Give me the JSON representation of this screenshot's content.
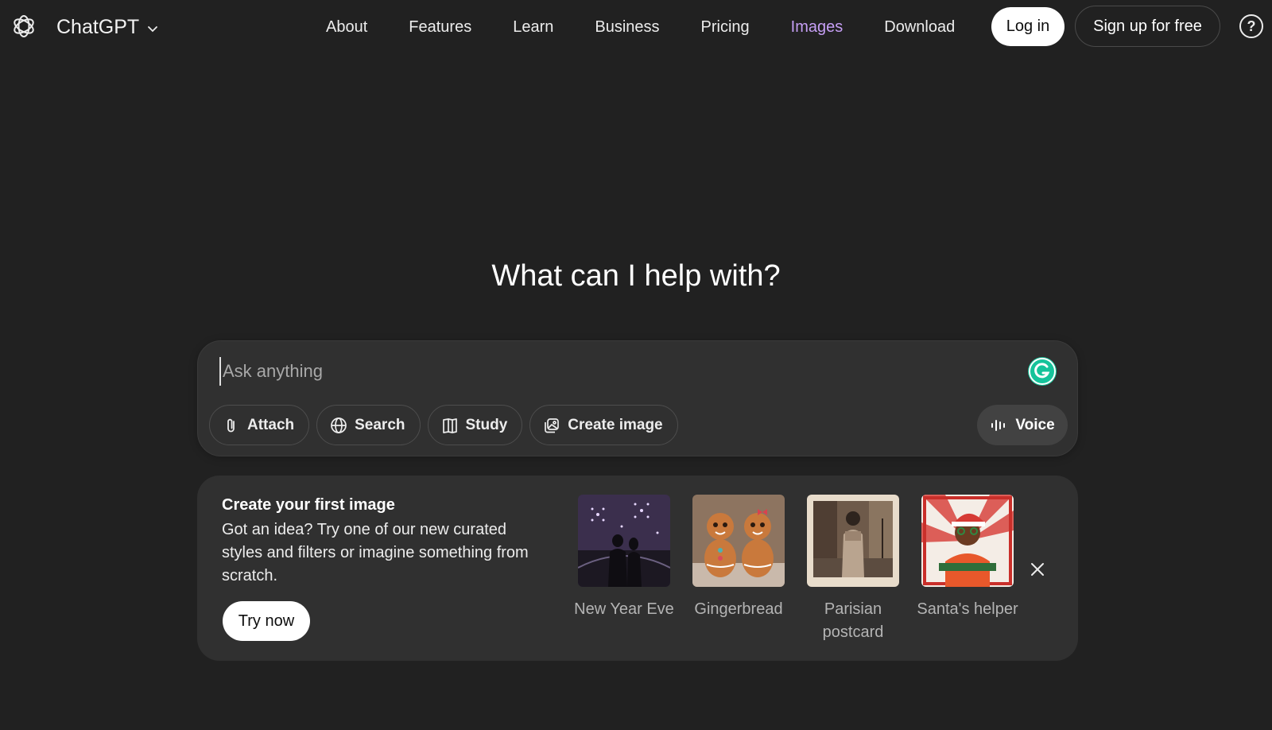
{
  "header": {
    "brand": "ChatGPT",
    "nav": [
      {
        "label": "About"
      },
      {
        "label": "Features"
      },
      {
        "label": "Learn"
      },
      {
        "label": "Business"
      },
      {
        "label": "Pricing"
      },
      {
        "label": "Images"
      },
      {
        "label": "Download"
      }
    ],
    "active_nav": "Images",
    "login_label": "Log in",
    "signup_label": "Sign up for free",
    "help_label": "?"
  },
  "hero": {
    "title": "What can I help with?"
  },
  "composer": {
    "placeholder": "Ask anything",
    "tools": {
      "attach": "Attach",
      "search": "Search",
      "study": "Study",
      "create_image": "Create image"
    },
    "voice_label": "Voice"
  },
  "promo": {
    "title": "Create your first image",
    "description": "Got an idea? Try one of our new curated styles and filters or imagine something from scratch.",
    "cta": "Try now",
    "styles": [
      {
        "label": "New Year Eve"
      },
      {
        "label": "Gingerbread"
      },
      {
        "label": "Parisian postcard"
      },
      {
        "label": "Santa's helper"
      }
    ]
  },
  "colors": {
    "background": "#212121",
    "surface": "#303030",
    "active_nav": "#c69ff5",
    "grammarly": "#15c39a"
  }
}
